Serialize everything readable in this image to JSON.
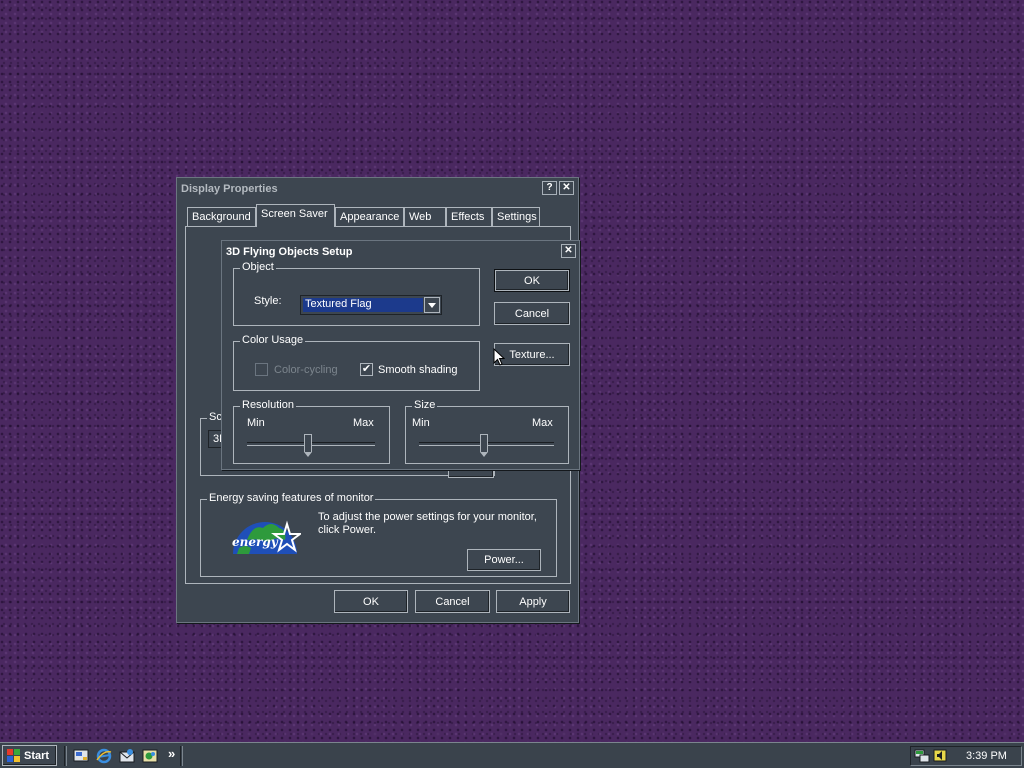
{
  "display_properties": {
    "title": "Display Properties",
    "help_label": "?",
    "close_label": "✕",
    "tabs": [
      "Background",
      "Screen Saver",
      "Appearance",
      "Web",
      "Effects",
      "Settings"
    ],
    "active_tab": "Screen Saver",
    "screensaver_group_legend_partial": "Sc",
    "screensaver_value_partial": "3D",
    "energy": {
      "legend": "Energy saving features of monitor",
      "description_line1": "To adjust the power settings for your monitor,",
      "description_line2": "click Power.",
      "power_button": "Power...",
      "logo_text": "energy"
    },
    "buttons": {
      "ok": "OK",
      "cancel": "Cancel",
      "apply": "Apply"
    }
  },
  "setup_dialog": {
    "title": "3D Flying Objects Setup",
    "close_label": "✕",
    "object_legend": "Object",
    "style_label": "Style:",
    "style_value": "Textured Flag",
    "color_usage_legend": "Color Usage",
    "color_cycling_label": "Color-cycling",
    "color_cycling_checked": false,
    "smooth_shading_label": "Smooth shading",
    "smooth_shading_checked": true,
    "check_mark": "✔",
    "resolution": {
      "legend": "Resolution",
      "min": "Min",
      "max": "Max",
      "level": 0.48
    },
    "size": {
      "legend": "Size",
      "min": "Min",
      "max": "Max",
      "level": 0.48
    },
    "buttons": {
      "ok": "OK",
      "cancel": "Cancel",
      "texture": "Texture..."
    }
  },
  "taskbar": {
    "start_label": "Start",
    "overflow_label": "»",
    "clock": "3:39 PM"
  },
  "icons": [
    "windows-flag-icon",
    "show-desktop-icon",
    "internet-explorer-icon",
    "outlook-express-icon",
    "channels-icon",
    "network-tray-icon",
    "volume-tray-icon",
    "mouse-cursor-icon"
  ],
  "colors": {
    "desktop": "#4a2860",
    "window_face": "#3d4650",
    "select_highlight": "#1c3a8c"
  }
}
